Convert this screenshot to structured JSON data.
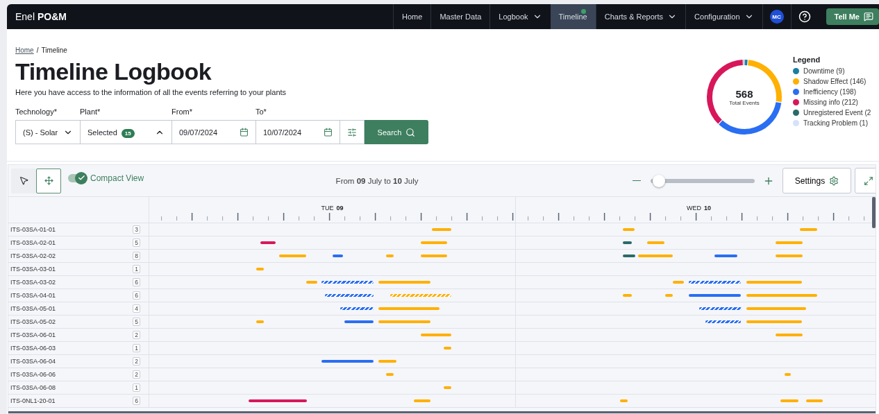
{
  "nav": {
    "brand": "Enel **PO&M**",
    "items": [
      {
        "label": "Home",
        "dropdown": false,
        "selected": false
      },
      {
        "label": "Master Data",
        "dropdown": false,
        "selected": false
      },
      {
        "label": "Logbook",
        "dropdown": true,
        "selected": false
      },
      {
        "label": "Timeline",
        "dropdown": false,
        "selected": true
      },
      {
        "label": "Charts & Reports",
        "dropdown": true,
        "selected": false
      },
      {
        "label": "Configuration",
        "dropdown": true,
        "selected": false
      }
    ],
    "avatar": "MC",
    "tell_me": "Tell Me"
  },
  "breadcrumb": {
    "items": [
      "Home",
      "Timeline"
    ],
    "separator": "/"
  },
  "title": "Timeline Logbook",
  "subtitle": "Here you have access to the information of all the events referring to your plants",
  "filters": {
    "technology": {
      "label": "Technology*",
      "value": "(S) - Solar"
    },
    "plant": {
      "label": "Plant*",
      "value": "Selected",
      "count": "15",
      "expanded": true
    },
    "from": {
      "label": "From*",
      "value": "09/07/2024"
    },
    "to": {
      "label": "To*",
      "value": "10/07/2024"
    },
    "search": "Search"
  },
  "summary": {
    "total": "568",
    "total_label": "Total Events",
    "legend_title": "Legend",
    "legend": [
      {
        "color": "#1a7ea3"
      },
      {
        "color": "#ffb000"
      },
      {
        "color": "#2a6ef2"
      },
      {
        "color": "#d8175a"
      },
      {
        "color": "#2b6b67"
      },
      {
        "color": "#d6e2fb"
      }
    ],
    "chart_data": {
      "type": "donut",
      "categories": [
        "Downtime (9)",
        "Shadow Effect (146)",
        "Inefficiency (198)",
        "Missing info (212)",
        "Unregistered Event (2",
        "Tracking Problem (1)"
      ],
      "values": [
        9,
        146,
        198,
        212,
        2,
        1
      ]
    }
  },
  "toolbar": {
    "tools": [
      {
        "kind": "pointer",
        "selected": false
      },
      {
        "kind": "move",
        "selected": true
      }
    ],
    "compact_view": {
      "label": "Compact View",
      "on": true
    },
    "range": "From **09** July to **10** July",
    "zoom": {
      "level": 0.02
    },
    "settings": "Settings"
  },
  "timeline": {
    "days": [
      {
        "weekday": "TUE",
        "date": "09"
      },
      {
        "weekday": "WED",
        "date": "10"
      }
    ],
    "rows": [
      {
        "label": "ITS-03SA-01-01",
        "count": "3"
      },
      {
        "label": "ITS-03SA-02-01",
        "count": "5"
      },
      {
        "label": "ITS-03SA-02-02",
        "count": "8"
      },
      {
        "label": "ITS-03SA-03-01",
        "count": "1"
      },
      {
        "label": "ITS-03SA-03-02",
        "count": "6"
      },
      {
        "label": "ITS-03SA-04-01",
        "count": "6"
      },
      {
        "label": "ITS-03SA-05-01",
        "count": "4"
      },
      {
        "label": "ITS-03SA-05-02",
        "count": "5"
      },
      {
        "label": "ITS-03SA-06-01",
        "count": "2"
      },
      {
        "label": "ITS-03SA-06-03",
        "count": "1"
      },
      {
        "label": "ITS-03SA-06-04",
        "count": "2"
      },
      {
        "label": "ITS-03SA-06-06",
        "count": "2"
      },
      {
        "label": "ITS-03SA-06-08",
        "count": "1"
      },
      {
        "label": "ITS-0NL1-20-01",
        "count": "6"
      }
    ]
  }
}
